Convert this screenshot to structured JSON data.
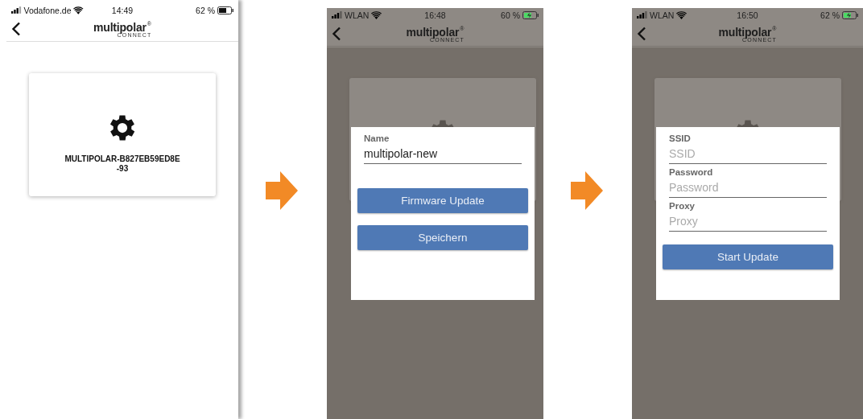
{
  "screens": [
    {
      "status": {
        "carrier": "Vodafone.de",
        "time": "14:49",
        "battery": "62 %",
        "charging": false
      },
      "header": {
        "logo": "multipolar",
        "logo_mark": "®",
        "logo_sub": "CONNECT"
      },
      "card": {
        "label": "MULTIPOLAR-B827EB59ED8E\n-93"
      },
      "overlay": false
    },
    {
      "status": {
        "carrier": "WLAN",
        "time": "16:48",
        "battery": "60 %",
        "charging": true
      },
      "header": {
        "logo": "multipolar",
        "logo_mark": "®",
        "logo_sub": "CONNECT"
      },
      "overlay": true,
      "dialog": [
        {
          "kind": "field",
          "label": "Name",
          "value": "multipolar-new"
        },
        {
          "kind": "button",
          "label": "Firmware Update"
        },
        {
          "kind": "button",
          "label": "Speichern"
        }
      ]
    },
    {
      "status": {
        "carrier": "WLAN",
        "time": "16:50",
        "battery": "62 %",
        "charging": true
      },
      "header": {
        "logo": "multipolar",
        "logo_mark": "®",
        "logo_sub": "CONNECT"
      },
      "overlay": true,
      "dialog": [
        {
          "kind": "field",
          "label": "SSID",
          "placeholder": "SSID"
        },
        {
          "kind": "field",
          "label": "Password",
          "placeholder": "Password"
        },
        {
          "kind": "field",
          "label": "Proxy",
          "placeholder": "Proxy"
        },
        {
          "kind": "button",
          "label": "Start Update"
        }
      ]
    }
  ]
}
